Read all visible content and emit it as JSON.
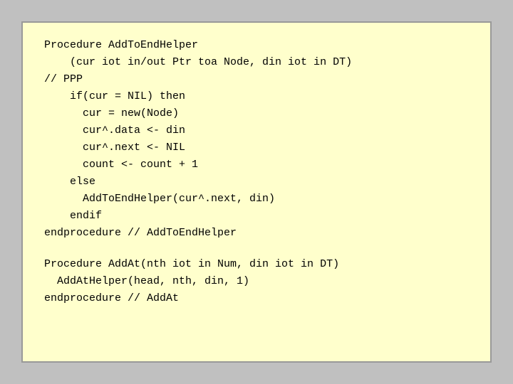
{
  "code": {
    "section1_lines": [
      "Procedure AddToEndHelper",
      "    (cur iot in/out Ptr toa Node, din iot in DT)",
      "// PPP",
      "    if(cur = NIL) then",
      "      cur = new(Node)",
      "      cur^.data <- din",
      "      cur^.next <- NIL",
      "      count <- count + 1",
      "    else",
      "      AddToEndHelper(cur^.next, din)",
      "    endif",
      "endprocedure // AddToEndHelper"
    ],
    "section2_lines": [
      "Procedure AddAt(nth iot in Num, din iot in DT)",
      "  AddAtHelper(head, nth, din, 1)",
      "endprocedure // AddAt"
    ]
  }
}
